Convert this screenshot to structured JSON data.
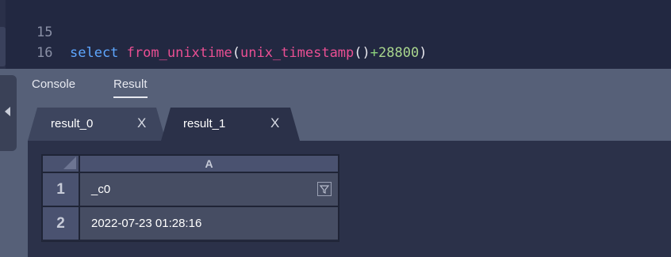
{
  "editor": {
    "lines": [
      {
        "number": "15",
        "tokens": {
          "keyword": "select",
          "fn1": "from_unixtime",
          "paren_open1": "(",
          "fn2": "unix_timestamp",
          "parens_empty": "()",
          "operator": "+",
          "number": "28800",
          "paren_close1": ")"
        }
      },
      {
        "number": "16"
      }
    ]
  },
  "panel": {
    "tabs": [
      {
        "label": "Console",
        "active": false
      },
      {
        "label": "Result",
        "active": true
      }
    ],
    "result_tabs": [
      {
        "label": "result_0",
        "close": "X",
        "active": false
      },
      {
        "label": "result_1",
        "close": "X",
        "active": true
      }
    ]
  },
  "grid": {
    "columns": [
      "A"
    ],
    "rows": [
      {
        "number": "1",
        "value": "_c0"
      },
      {
        "number": "2",
        "value": "2022-07-23 01:28:16"
      }
    ]
  },
  "icons": {
    "collapse": "chevron-left-icon",
    "filter": "filter-icon",
    "close": "close-icon"
  }
}
